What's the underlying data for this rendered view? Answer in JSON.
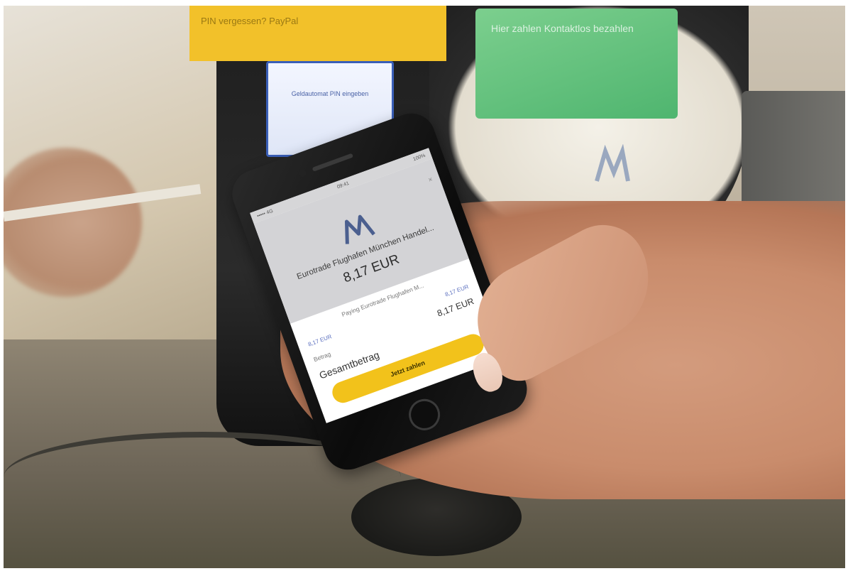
{
  "background": {
    "paypal_banner_text": "PIN vergessen?  PayPal",
    "reader_screen_text": "Geldautomat  PIN eingeben",
    "terminal_screen_text": "Hier zahlen  Kontaktlos bezahlen"
  },
  "phone": {
    "status_left": "••••• 4G",
    "status_time": "09:41",
    "status_right": "100%",
    "close_icon": "×",
    "merchant_name": "Eurotrade Flughafen München Handel...",
    "amount": "8,17 EUR",
    "paying_line": "Paying Eurotrade Flughafen M...",
    "item_price_left": "8,17 EUR",
    "item_price_right": "8,17 EUR",
    "betrag_label": "Betrag",
    "betrag_value": "8,17 EUR",
    "total_label": "Gesamtbetrag",
    "pay_button": "Jetzt zahlen"
  },
  "colors": {
    "pay_button": "#f2c21b",
    "hero_bg": "#d3d3d6",
    "brand_logo": "#4b5f8f"
  }
}
